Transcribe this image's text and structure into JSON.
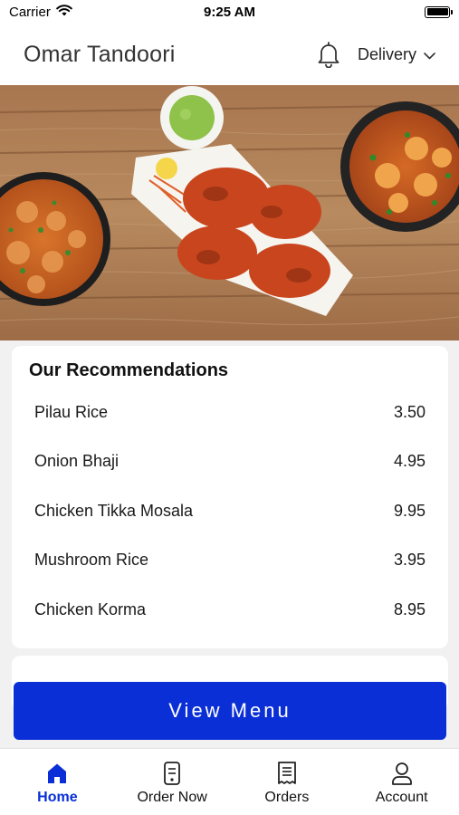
{
  "status_bar": {
    "carrier": "Carrier",
    "time": "9:25 AM"
  },
  "header": {
    "title": "Omar Tandoori",
    "delivery_option": "Delivery",
    "bell_icon": "bell-icon"
  },
  "recommendations": {
    "title": "Our Recommendations",
    "items": [
      {
        "name": "Pilau Rice",
        "price": "3.50"
      },
      {
        "name": "Onion Bhaji",
        "price": "4.95"
      },
      {
        "name": "Chicken Tikka Mosala",
        "price": "9.95"
      },
      {
        "name": "Mushroom Rice",
        "price": "3.95"
      },
      {
        "name": "Chicken Korma",
        "price": "8.95"
      }
    ]
  },
  "view_menu_label": "View Menu",
  "tabs": [
    {
      "label": "Home",
      "icon": "home-icon",
      "active": true
    },
    {
      "label": "Order Now",
      "icon": "order-icon",
      "active": false
    },
    {
      "label": "Orders",
      "icon": "receipt-icon",
      "active": false
    },
    {
      "label": "Account",
      "icon": "user-icon",
      "active": false
    }
  ],
  "colors": {
    "accent": "#0a2fd6",
    "background": "#f1f1f1"
  }
}
